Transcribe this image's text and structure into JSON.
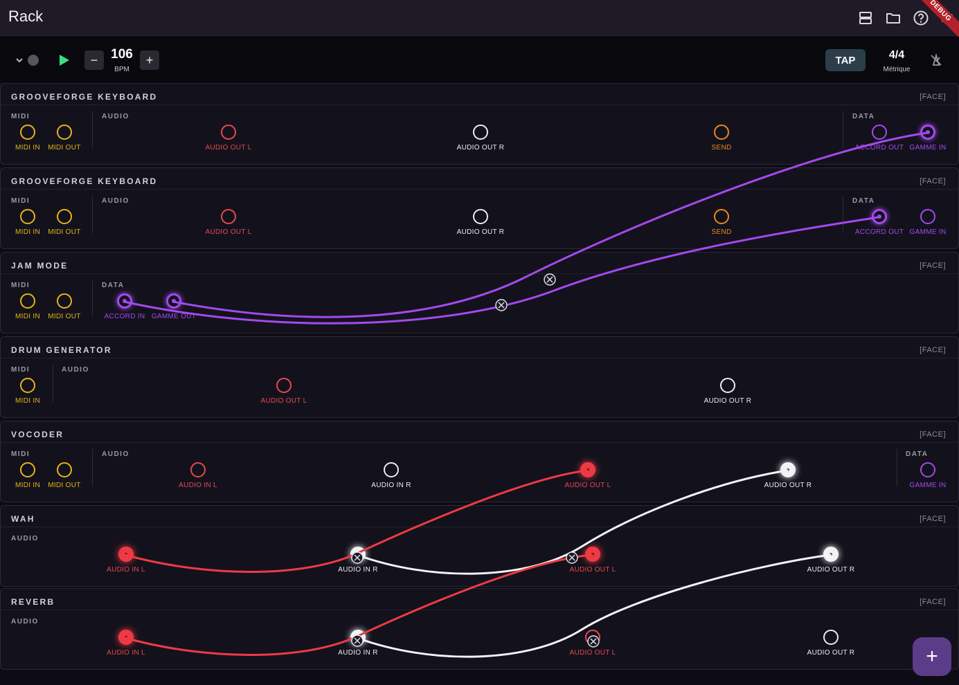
{
  "app": {
    "title": "Rack",
    "debug_banner": "DEBUG"
  },
  "appbar_icons": [
    "view-rows-icon",
    "folder-icon",
    "help-icon",
    "settings-icon"
  ],
  "transport": {
    "bpm_value": "106",
    "bpm_label": "BPM",
    "minus": "−",
    "plus": "+",
    "tap_label": "TAP",
    "meter_value": "4/4",
    "meter_label": "Métrique"
  },
  "colors": {
    "midi": "#e6b417",
    "audio_left": "#e8484f",
    "audio_right": "#ececf2",
    "send": "#e88a20",
    "data": "#a449ee"
  },
  "rows": [
    {
      "title": "GROOVEFORGE KEYBOARD",
      "face": "[FACE]",
      "sections": {
        "midi": "MIDI",
        "audio": "AUDIO",
        "data": "DATA"
      },
      "ports": [
        "MIDI IN",
        "MIDI OUT",
        "AUDIO OUT L",
        "AUDIO OUT R",
        "SEND",
        "ACCORD OUT",
        "GAMME IN"
      ]
    },
    {
      "title": "GROOVEFORGE KEYBOARD",
      "face": "[FACE]",
      "sections": {
        "midi": "MIDI",
        "audio": "AUDIO",
        "data": "DATA"
      },
      "ports": [
        "MIDI IN",
        "MIDI OUT",
        "AUDIO OUT L",
        "AUDIO OUT R",
        "SEND",
        "ACCORD OUT",
        "GAMME IN"
      ]
    },
    {
      "title": "JAM MODE",
      "face": "[FACE]",
      "sections": {
        "midi": "MIDI",
        "data": "DATA"
      },
      "ports": [
        "MIDI IN",
        "MIDI OUT",
        "ACCORD IN",
        "GAMME OUT"
      ]
    },
    {
      "title": "DRUM GENERATOR",
      "face": "[FACE]",
      "sections": {
        "midi": "MIDI",
        "audio": "AUDIO"
      },
      "ports": [
        "MIDI IN",
        "AUDIO OUT L",
        "AUDIO OUT R"
      ]
    },
    {
      "title": "VOCODER",
      "face": "[FACE]",
      "sections": {
        "midi": "MIDI",
        "audio": "AUDIO",
        "data": "DATA"
      },
      "ports": [
        "MIDI IN",
        "MIDI OUT",
        "AUDIO IN L",
        "AUDIO IN R",
        "AUDIO OUT L",
        "AUDIO OUT R",
        "GAMME IN"
      ]
    },
    {
      "title": "WAH",
      "face": "[FACE]",
      "sections": {
        "audio": "AUDIO"
      },
      "ports": [
        "AUDIO IN L",
        "AUDIO IN R",
        "AUDIO OUT L",
        "AUDIO OUT R"
      ]
    },
    {
      "title": "REVERB",
      "face": "[FACE]",
      "sections": {
        "audio": "AUDIO"
      },
      "ports": [
        "AUDIO IN L",
        "AUDIO IN R",
        "AUDIO OUT L",
        "AUDIO OUT R"
      ]
    }
  ],
  "cables": [
    {
      "from": "JAM MODE · ACCORD IN",
      "to": "GROOVEFORGE KEYBOARD 2 · ACCORD OUT",
      "color": "#a449ee"
    },
    {
      "from": "JAM MODE · GAMME OUT",
      "to": "GROOVEFORGE KEYBOARD 1 · GAMME IN",
      "color": "#a449ee"
    },
    {
      "from": "VOCODER · AUDIO OUT L",
      "to": "WAH · AUDIO IN L",
      "color": "#ee3a44"
    },
    {
      "from": "VOCODER · AUDIO OUT R",
      "to": "WAH · AUDIO IN R",
      "color": "#f3f3f6"
    },
    {
      "from": "WAH · AUDIO OUT L",
      "to": "REVERB · AUDIO IN L",
      "color": "#ee3a44"
    },
    {
      "from": "WAH · AUDIO OUT R",
      "to": "REVERB · AUDIO IN R",
      "color": "#f3f3f6"
    }
  ],
  "fab_label": "+"
}
